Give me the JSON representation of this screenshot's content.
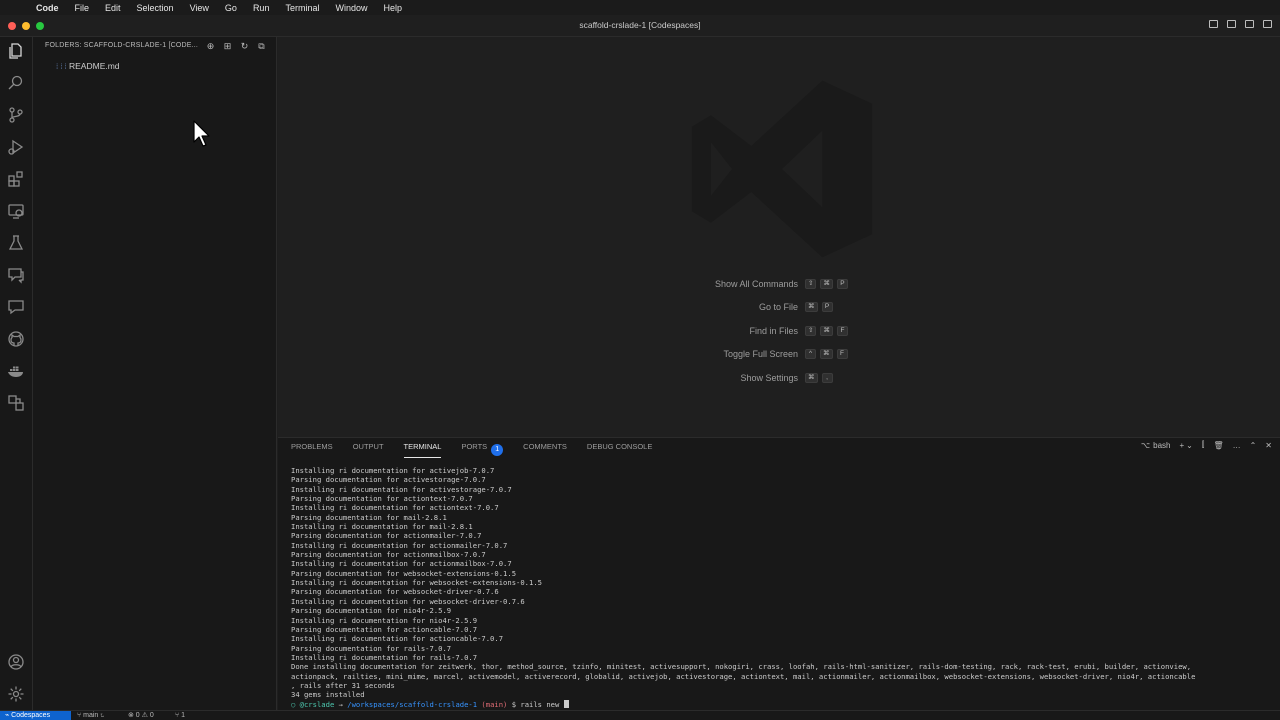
{
  "menubar": {
    "apple_glyph": "",
    "items": [
      "Code",
      "File",
      "Edit",
      "Selection",
      "View",
      "Go",
      "Run",
      "Terminal",
      "Window",
      "Help"
    ]
  },
  "window": {
    "title": "scaffold-crslade-1 [Codespaces]",
    "traffic_colors": {
      "close": "#ff5f57",
      "minimize": "#febc2e",
      "zoom": "#28c840"
    }
  },
  "activity_bar": {
    "icons": [
      "explorer-icon",
      "search-icon",
      "source-control-icon",
      "run-debug-icon",
      "extensions-icon",
      "remote-explorer-icon",
      "testing-icon",
      "comments-icon",
      "chat-icon",
      "github-icon",
      "docker-icon",
      "live-share-icon"
    ],
    "bottom_icons": [
      "accounts-icon",
      "manage-icon"
    ]
  },
  "sidebar": {
    "header": "FOLDERS: SCAFFOLD-CRSLADE-1 [CODE...",
    "files": [
      {
        "name": "README.md",
        "icon": "markdown-icon",
        "glyph": "⁞⁞⁞"
      }
    ]
  },
  "editor": {
    "hints": [
      {
        "label": "Show All Commands",
        "keys": [
          "⇧",
          "⌘",
          "P"
        ]
      },
      {
        "label": "Go to File",
        "keys": [
          "⌘",
          "P"
        ]
      },
      {
        "label": "Find in Files",
        "keys": [
          "⇧",
          "⌘",
          "F"
        ]
      },
      {
        "label": "Toggle Full Screen",
        "keys": [
          "^",
          "⌘",
          "F"
        ]
      },
      {
        "label": "Show Settings",
        "keys": [
          "⌘",
          ","
        ]
      }
    ]
  },
  "panel": {
    "tabs": [
      {
        "label": "PROBLEMS"
      },
      {
        "label": "OUTPUT"
      },
      {
        "label": "TERMINAL",
        "active": true
      },
      {
        "label": "PORTS",
        "badge": "1"
      },
      {
        "label": "COMMENTS"
      },
      {
        "label": "DEBUG CONSOLE"
      }
    ],
    "shell": "bash",
    "terminal_lines": [
      "Installing ri documentation for activejob-7.0.7",
      "Parsing documentation for activestorage-7.0.7",
      "Installing ri documentation for activestorage-7.0.7",
      "Parsing documentation for actiontext-7.0.7",
      "Installing ri documentation for actiontext-7.0.7",
      "Parsing documentation for mail-2.8.1",
      "Installing ri documentation for mail-2.8.1",
      "Parsing documentation for actionmailer-7.0.7",
      "Installing ri documentation for actionmailer-7.0.7",
      "Parsing documentation for actionmailbox-7.0.7",
      "Installing ri documentation for actionmailbox-7.0.7",
      "Parsing documentation for websocket-extensions-0.1.5",
      "Installing ri documentation for websocket-extensions-0.1.5",
      "Parsing documentation for websocket-driver-0.7.6",
      "Installing ri documentation for websocket-driver-0.7.6",
      "Parsing documentation for nio4r-2.5.9",
      "Installing ri documentation for nio4r-2.5.9",
      "Parsing documentation for actioncable-7.0.7",
      "Installing ri documentation for actioncable-7.0.7",
      "Parsing documentation for rails-7.0.7",
      "Installing ri documentation for rails-7.0.7",
      "Done installing documentation for zeitwerk, thor, method_source, tzinfo, minitest, activesupport, nokogiri, crass, loofah, rails-html-sanitizer, rails-dom-testing, rack, rack-test, erubi, builder, actionview,",
      "actionpack, railties, mini_mime, marcel, activemodel, activerecord, globalid, activejob, activestorage, actiontext, mail, actionmailer, actionmailbox, websocket-extensions, websocket-driver, nio4r, actioncable",
      ", rails after 31 seconds",
      "34 gems installed"
    ],
    "prompt": {
      "marker": "○",
      "user": "@crslade",
      "arrow": "→",
      "path": "/workspaces/scaffold-crslade-1",
      "branch": "(main)",
      "symbol": "$",
      "command": "rails new "
    }
  },
  "statusbar": {
    "remote": "⌁ Codespaces",
    "branch": "⑂ main ↻",
    "problems": "⊗ 0 ⚠ 0",
    "ports": "⑂ 1"
  }
}
